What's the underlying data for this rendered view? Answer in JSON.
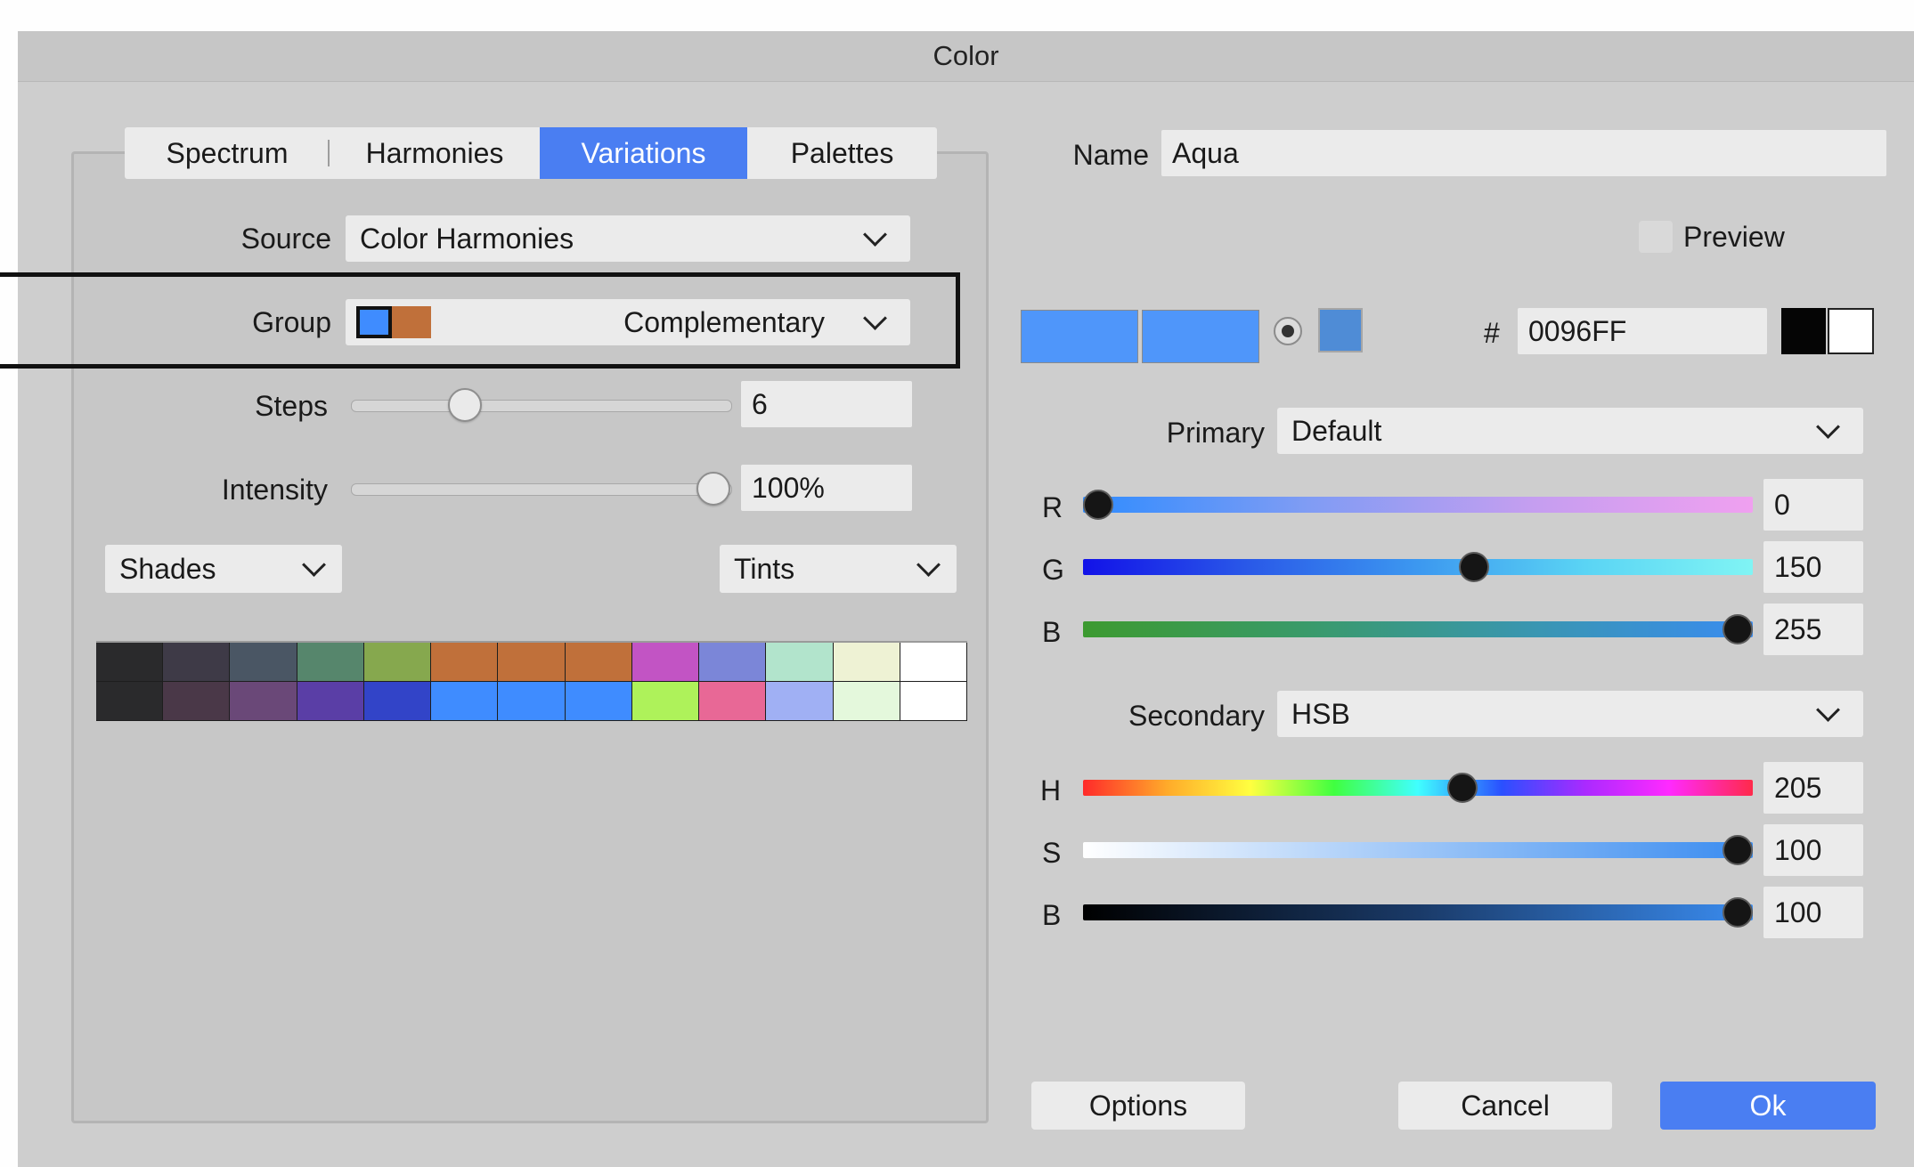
{
  "window": {
    "title": "Color"
  },
  "tabs": [
    {
      "label": "Spectrum",
      "active": false
    },
    {
      "label": "Harmonies",
      "active": false
    },
    {
      "label": "Variations",
      "active": true
    },
    {
      "label": "Palettes",
      "active": false
    }
  ],
  "left": {
    "source": {
      "label": "Source",
      "value": "Color Harmonies"
    },
    "group": {
      "label": "Group",
      "value": "Complementary",
      "swatch_colors": [
        "#3f8cff",
        "#c0703a"
      ]
    },
    "steps": {
      "label": "Steps",
      "value": "6",
      "fraction": 0.28
    },
    "intensity": {
      "label": "Intensity",
      "value": "100%",
      "fraction": 1.0
    },
    "shades": {
      "value": "Shades"
    },
    "tints": {
      "value": "Tints"
    },
    "variations_grid": [
      [
        "#2a2a2c",
        "#3e3a47",
        "#4a5664",
        "#56866c",
        "#86a84e",
        "#c0703a",
        "#c0703a",
        "#c0703a",
        "#c254c4",
        "#7b86d8",
        "#b2e4cc",
        "#eef2d4",
        "#ffffff"
      ],
      [
        "#2a2a2c",
        "#4a3848",
        "#6a4878",
        "#5a3ea6",
        "#3244c8",
        "#3f8cff",
        "#3f8cff",
        "#3f8cff",
        "#aef25a",
        "#e86896",
        "#a0b0f4",
        "#e4f8dc",
        "#ffffff"
      ]
    ]
  },
  "right": {
    "name": {
      "label": "Name",
      "value": "Aqua"
    },
    "preview": {
      "label": "Preview",
      "checked": false
    },
    "hex": {
      "label": "#",
      "value": "0096FF"
    },
    "color_wells": {
      "current": "#4f96fa",
      "previous": "#4f96fa",
      "small": "#4f8cd6"
    },
    "primary": {
      "label": "Primary",
      "mode": "Default",
      "channels": [
        {
          "label": "R",
          "value": "0",
          "fraction": 0.0
        },
        {
          "label": "G",
          "value": "150",
          "fraction": 0.588
        },
        {
          "label": "B",
          "value": "255",
          "fraction": 1.0
        }
      ]
    },
    "secondary": {
      "label": "Secondary",
      "mode": "HSB",
      "channels": [
        {
          "label": "H",
          "value": "205",
          "fraction": 0.569
        },
        {
          "label": "S",
          "value": "100",
          "fraction": 1.0
        },
        {
          "label": "B",
          "value": "100",
          "fraction": 1.0
        }
      ]
    }
  },
  "buttons": {
    "options": "Options",
    "cancel": "Cancel",
    "ok": "Ok"
  },
  "colors": {
    "accent": "#4a7ef2",
    "dialog_bg": "#cecece",
    "field_bg": "#ebebeb"
  }
}
